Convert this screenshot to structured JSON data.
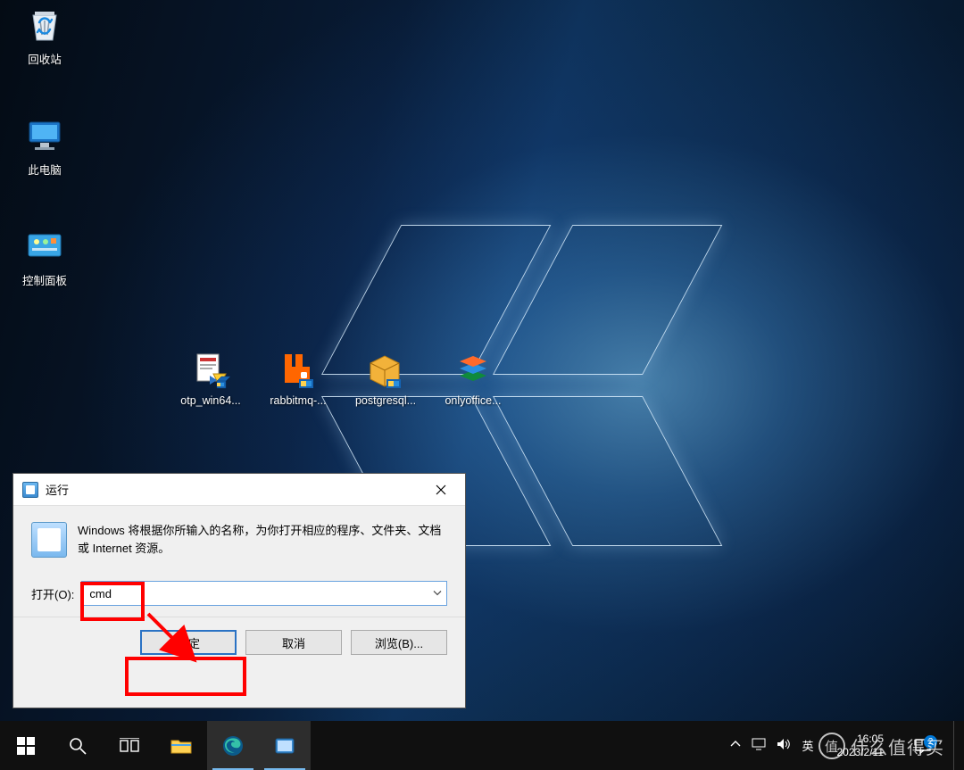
{
  "desktop": {
    "icons": [
      {
        "id": "recycle-bin",
        "label": "回收站"
      },
      {
        "id": "this-pc",
        "label": "此电脑"
      },
      {
        "id": "control-panel",
        "label": "控制面板"
      },
      {
        "id": "otp",
        "label": "otp_win64..."
      },
      {
        "id": "rabbitmq",
        "label": "rabbitmq-..."
      },
      {
        "id": "postgresql",
        "label": "postgresql..."
      },
      {
        "id": "onlyoffice",
        "label": "onlyoffice..."
      }
    ]
  },
  "run_dialog": {
    "title": "运行",
    "description": "Windows 将根据你所输入的名称，为你打开相应的程序、文件夹、文档或 Internet 资源。",
    "open_label": "打开(O):",
    "input_value": "cmd",
    "buttons": {
      "ok": "确定",
      "cancel": "取消",
      "browse": "浏览(B)..."
    }
  },
  "taskbar": {
    "ime": "英",
    "time": "16:05",
    "date": "2023/2/11",
    "notif_count": "2"
  },
  "watermark": {
    "badge": "值",
    "text": "什么值得买"
  }
}
